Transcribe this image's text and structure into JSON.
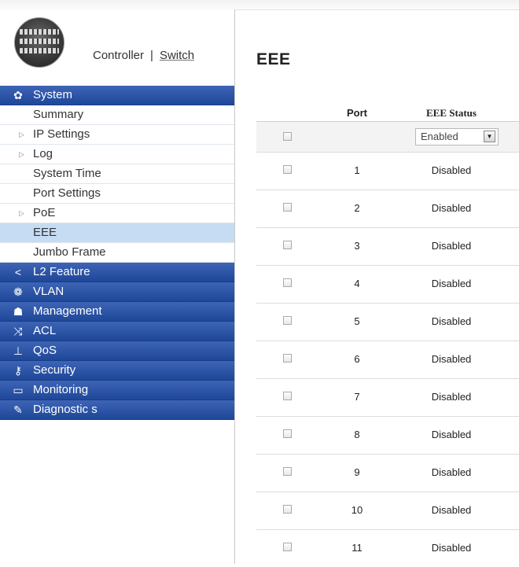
{
  "header": {
    "controller_label": "Controller",
    "separator": "|",
    "switch_label": "Switch"
  },
  "sidebar": {
    "system": {
      "label": "System",
      "icon": "gear-icon"
    },
    "system_items": [
      {
        "label": "Summary",
        "expandable": false
      },
      {
        "label": "IP Settings",
        "expandable": true
      },
      {
        "label": "Log",
        "expandable": true
      },
      {
        "label": "System Time",
        "expandable": false
      },
      {
        "label": "Port Settings",
        "expandable": false
      },
      {
        "label": "PoE",
        "expandable": true
      },
      {
        "label": "EEE",
        "expandable": false,
        "active": true
      },
      {
        "label": "Jumbo Frame",
        "expandable": false
      }
    ],
    "categories": [
      {
        "label": "L2 Feature",
        "icon": "share-icon"
      },
      {
        "label": "VLAN",
        "icon": "network-icon"
      },
      {
        "label": "Management",
        "icon": "user-icon"
      },
      {
        "label": "ACL",
        "icon": "shuffle-icon"
      },
      {
        "label": "QoS",
        "icon": "hierarchy-icon"
      },
      {
        "label": "Security",
        "icon": "key-icon"
      },
      {
        "label": "Monitoring",
        "icon": "monitor-icon"
      },
      {
        "label": "Diagnostic s",
        "icon": "wrench-icon"
      }
    ]
  },
  "main": {
    "title": "EEE",
    "table": {
      "col_port": "Port",
      "col_status": "EEE Status",
      "bulk_select_value": "Enabled",
      "rows": [
        {
          "port": "1",
          "status": "Disabled"
        },
        {
          "port": "2",
          "status": "Disabled"
        },
        {
          "port": "3",
          "status": "Disabled"
        },
        {
          "port": "4",
          "status": "Disabled"
        },
        {
          "port": "5",
          "status": "Disabled"
        },
        {
          "port": "6",
          "status": "Disabled"
        },
        {
          "port": "7",
          "status": "Disabled"
        },
        {
          "port": "8",
          "status": "Disabled"
        },
        {
          "port": "9",
          "status": "Disabled"
        },
        {
          "port": "10",
          "status": "Disabled"
        },
        {
          "port": "11",
          "status": "Disabled"
        }
      ]
    }
  },
  "colors": {
    "nav_blue": "#1f4799",
    "active_item": "#c6dcf2"
  }
}
